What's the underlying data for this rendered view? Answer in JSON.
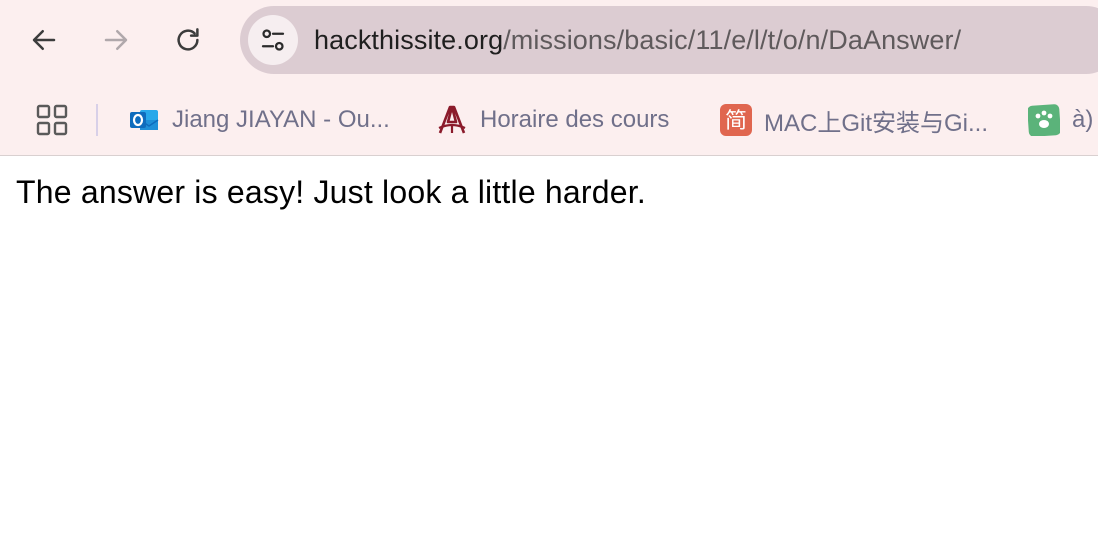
{
  "browser": {
    "url_host": "hackthissite.org",
    "url_path": "/missions/basic/11/e/l/t/o/n/DaAnswer/",
    "icons": {
      "back": "arrow-left-icon",
      "forward": "arrow-right-icon",
      "reload": "reload-icon",
      "site_info": "tune-icon",
      "apps": "apps-grid-icon"
    },
    "colors": {
      "toolbar_bg": "#fcefef",
      "omnibox_bg": "#dcccd2",
      "bookmark_text": "#70708a"
    }
  },
  "bookmarks": [
    {
      "label": "Jiang JIAYAN - Ou...",
      "icon": "outlook-icon",
      "color": "#1a6fd1"
    },
    {
      "label": "Horaire des cours",
      "icon": "university-logo-icon",
      "color": "#8b1b2b"
    },
    {
      "label": "MAC上Git安装与Gi...",
      "icon": "jianshu-icon",
      "glyph": "简",
      "color": "#e0664f"
    },
    {
      "label": "à)",
      "icon": "paw-icon",
      "color": "#5bb37a"
    }
  ],
  "page": {
    "message": "The answer is easy! Just look a little harder."
  }
}
